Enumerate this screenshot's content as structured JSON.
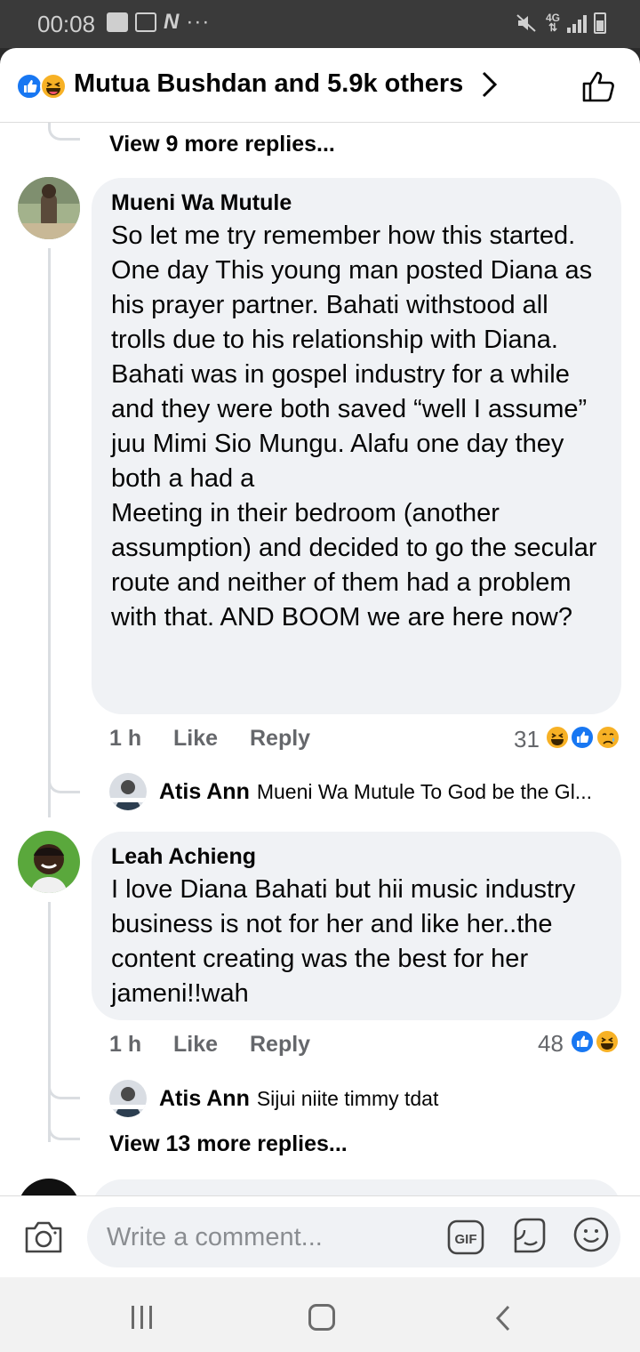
{
  "status_bar": {
    "time": "00:08",
    "network": "4G"
  },
  "reactions_header": {
    "title": "Mutua Bushdan and 5.9k others",
    "icons": [
      "like-reaction-icon",
      "haha-reaction-icon"
    ]
  },
  "top_more_replies": "View 9 more replies...",
  "comments": [
    {
      "author": "Mueni Wa Mutule",
      "text": "So let me try remember how this started. One day This young man posted Diana as his prayer partner. Bahati  withstood all trolls due to his relationship with Diana. Bahati was in gospel industry for a while and they were both saved “well I assume” juu Mimi Sio Mungu. Alafu one day they both a had a\nMeeting in their bedroom (another assumption) and decided to go the secular route and neither of them had a problem with that. AND BOOM we are here now?",
      "time": "1 h",
      "like_label": "Like",
      "reply_label": "Reply",
      "reaction_count": "31",
      "reaction_icons": [
        "haha-reaction-icon",
        "like-reaction-icon",
        "sad-reaction-icon"
      ],
      "reply": {
        "author": "Atis Ann",
        "text": "Mueni Wa Mutule To God be the Gl..."
      }
    },
    {
      "author": "Leah Achieng",
      "text": "I love Diana  Bahati  but hii music industry business is not for her and like her..the content creating was the best for her jameni!!wah",
      "time": "1 h",
      "like_label": "Like",
      "reply_label": "Reply",
      "reaction_count": "48",
      "reaction_icons": [
        "like-reaction-icon",
        "haha-reaction-icon"
      ],
      "reply": {
        "author": "Atis Ann",
        "text": "Sijui niite timmy tdat"
      },
      "more_replies": "View 13 more replies..."
    }
  ],
  "composer": {
    "placeholder": "Write a comment...",
    "gif_label": "GIF"
  },
  "colors": {
    "like_blue": "#1877f2",
    "haha_yellow": "#f7b125",
    "bubble_bg": "#f0f2f5",
    "meta_gray": "#65676b"
  }
}
